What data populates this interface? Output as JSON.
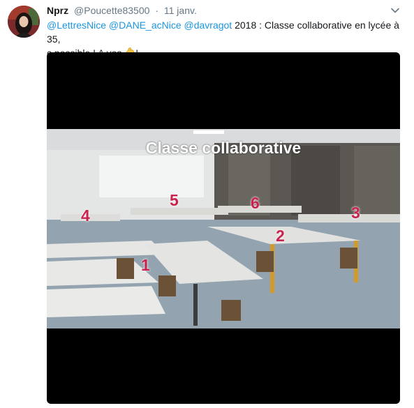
{
  "tweet": {
    "author_name": "Nprz",
    "author_handle": "@Poucette83500",
    "separator": "·",
    "date": "11 janv.",
    "mentions": [
      "@LettresNice",
      "@DANE_acNice",
      "@davragot"
    ],
    "text_line1_rest": "2018 : Classe collaborative en lycée à 35,",
    "text_line2": "c possible ! A vos",
    "text_end": "!",
    "emoji": "flexed-biceps-icon"
  },
  "media": {
    "overlay_title": "Classe collaborative",
    "table_numbers": [
      "1",
      "2",
      "3",
      "4",
      "5",
      "6"
    ]
  },
  "colors": {
    "mention": "#1b95e0",
    "secondary_text": "#657786",
    "number_label": "#c8224d"
  }
}
